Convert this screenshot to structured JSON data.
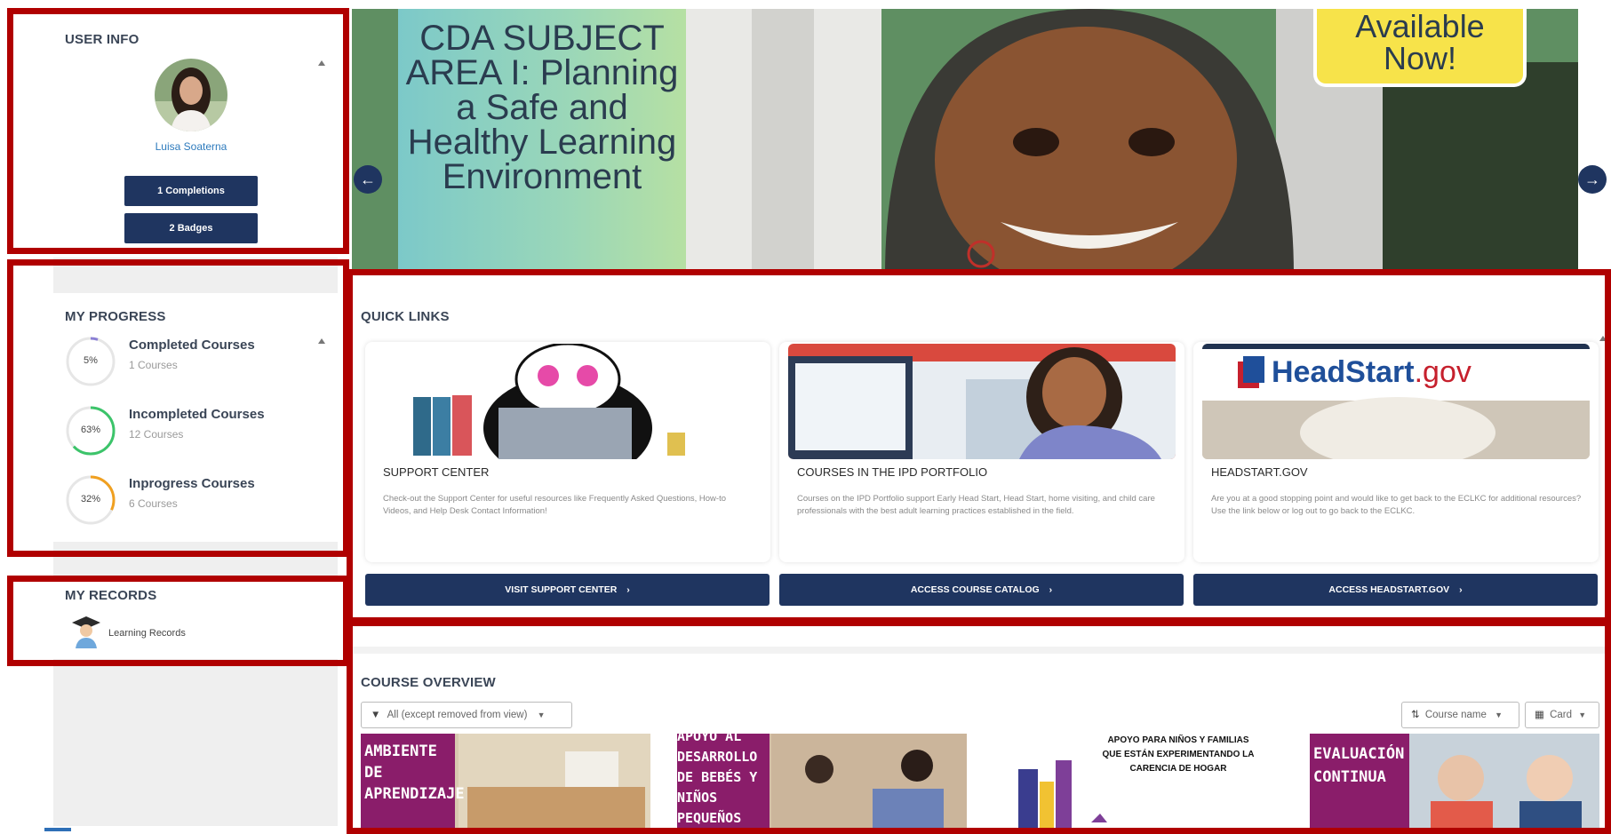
{
  "user_info": {
    "title": "USER INFO",
    "name": "Luisa Soaterna",
    "completions_label": "1 Completions",
    "badges_label": "2 Badges"
  },
  "my_progress": {
    "title": "MY PROGRESS",
    "items": [
      {
        "label": "Completed Courses",
        "count": "1 Courses",
        "percent_label": "5%",
        "percent": 5,
        "color": "#8a7fd4"
      },
      {
        "label": "Incompleted Courses",
        "count": "12 Courses",
        "percent_label": "63%",
        "percent": 63,
        "color": "#3cc46a"
      },
      {
        "label": "Inprogress Courses",
        "count": "6 Courses",
        "percent_label": "32%",
        "percent": 32,
        "color": "#f0a020"
      }
    ]
  },
  "my_records": {
    "title": "MY RECORDS",
    "learning_records_label": "Learning Records"
  },
  "hero": {
    "slide_text": "CDA SUBJECT AREA I: Planning a Safe and Healthy Learning Environment",
    "badge_text": "Available Now!",
    "prev_icon": "arrow-left-icon",
    "next_icon": "arrow-right-icon"
  },
  "quick_links": {
    "title": "QUICK LINKS",
    "cards": [
      {
        "title": "SUPPORT CENTER",
        "description": "Check-out the Support Center for useful resources like Frequently Asked Questions, How-to Videos, and Help Desk Contact Information!",
        "button": "VISIT SUPPORT CENTER"
      },
      {
        "title": "COURSES IN THE IPD PORTFOLIO",
        "description": "Courses on the IPD Portfolio support Early Head Start, Head Start, home visiting, and child care professionals with the best adult learning practices established in the field.",
        "button": "ACCESS COURSE CATALOG"
      },
      {
        "title": "HEADSTART.GOV",
        "description": "Are you at a good stopping point and would like to get back to the ECLKC for additional resources? Use the link below or log out to go back to the ECLKC.",
        "button": "ACCESS HEADSTART.GOV",
        "logo_main": "HeadStart",
        "logo_suffix": ".gov"
      }
    ],
    "button_chevron": "›"
  },
  "course_overview": {
    "title": "COURSE OVERVIEW",
    "filter_label": "All (except removed from view)",
    "sort_label": "Course name",
    "view_label": "Card",
    "courses": [
      {
        "banner": "AMBIENTE DE APRENDIZAJE"
      },
      {
        "banner": "APOYO AL DESARROLLO DE BEBÉS Y NIÑOS PEQUEÑOS"
      },
      {
        "banner": "APOYO PARA NIÑOS Y FAMILIAS QUE ESTÁN EXPERIMENTANDO LA CARENCIA DE HOGAR"
      },
      {
        "banner": "EVALUACIÓN CONTINUA"
      }
    ]
  },
  "colors": {
    "navy": "#1f3560",
    "highlight_red": "#b00000"
  }
}
